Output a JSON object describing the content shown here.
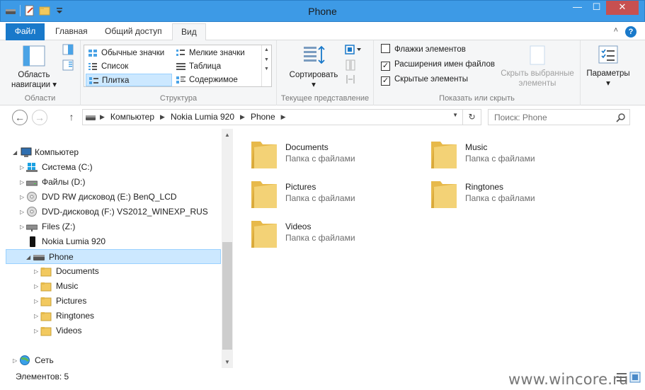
{
  "window": {
    "title": "Phone",
    "controls": {
      "minimize": "—",
      "maximize": "☐",
      "close": "✕"
    }
  },
  "ribbon_tabs": [
    {
      "label": "Файл"
    },
    {
      "label": "Главная"
    },
    {
      "label": "Общий доступ"
    },
    {
      "label": "Вид"
    }
  ],
  "ribbon_tabs_right": {
    "collapse": "˄",
    "help": "?"
  },
  "groups": {
    "panes": {
      "label": "Области",
      "nav_pane": {
        "line1": "Область",
        "line2": "навигации"
      }
    },
    "layout": {
      "label": "Структура",
      "items": [
        "Обычные значки",
        "Мелкие значки",
        "Список",
        "Таблица",
        "Плитка",
        "Содержимое"
      ],
      "selected": "Плитка"
    },
    "current_view": {
      "label": "Текущее представление",
      "sort": "Сортировать"
    },
    "show_hide": {
      "label": "Показать или скрыть",
      "checkboxes": [
        {
          "label": "Флажки элементов",
          "checked": false
        },
        {
          "label": "Расширения имен файлов",
          "checked": true
        },
        {
          "label": "Скрытые элементы",
          "checked": true
        }
      ],
      "hide_selected": {
        "line1": "Скрыть выбранные",
        "line2": "элементы"
      }
    },
    "options": {
      "label": "Параметры"
    }
  },
  "breadcrumb": [
    "Компьютер",
    "Nokia Lumia 920",
    "Phone"
  ],
  "search": {
    "placeholder": "Поиск: Phone"
  },
  "tree": [
    {
      "label": "Компьютер",
      "icon": "computer-icon",
      "level": 0,
      "expanded": true
    },
    {
      "label": "Система (C:)",
      "icon": "windows-drive-icon",
      "level": 1
    },
    {
      "label": "Файлы (D:)",
      "icon": "drive-icon",
      "level": 1
    },
    {
      "label": "DVD RW дисковод (E:) BenQ_LCD",
      "icon": "dvd-icon",
      "level": 1
    },
    {
      "label": "DVD-дисковод (F:) VS2012_WINEXP_RUS",
      "icon": "dvd-icon",
      "level": 1
    },
    {
      "label": "Files (Z:)",
      "icon": "network-drive-icon",
      "level": 1
    },
    {
      "label": "Nokia Lumia 920",
      "icon": "phone-icon",
      "level": 1
    },
    {
      "label": "Phone",
      "icon": "drive-icon",
      "level": 2,
      "selected": true,
      "expanded": true
    },
    {
      "label": "Documents",
      "icon": "folder-icon",
      "level": 3
    },
    {
      "label": "Music",
      "icon": "folder-icon",
      "level": 3
    },
    {
      "label": "Pictures",
      "icon": "folder-icon",
      "level": 3
    },
    {
      "label": "Ringtones",
      "icon": "folder-icon",
      "level": 3
    },
    {
      "label": "Videos",
      "icon": "folder-icon",
      "level": 3
    },
    {
      "label": "Сеть",
      "icon": "network-icon",
      "level": 0
    }
  ],
  "items": [
    {
      "name": "Documents",
      "type": "Папка с файлами"
    },
    {
      "name": "Music",
      "type": "Папка с файлами"
    },
    {
      "name": "Pictures",
      "type": "Папка с файлами"
    },
    {
      "name": "Ringtones",
      "type": "Папка с файлами"
    },
    {
      "name": "Videos",
      "type": "Папка с файлами"
    }
  ],
  "status": {
    "count": "Элементов: 5"
  },
  "watermark": "www.wincore.ru",
  "colors": {
    "accent": "#1979ca",
    "titlebar": "#3d9ae6",
    "selection": "#cce8ff",
    "folder": "#f2c95f"
  }
}
